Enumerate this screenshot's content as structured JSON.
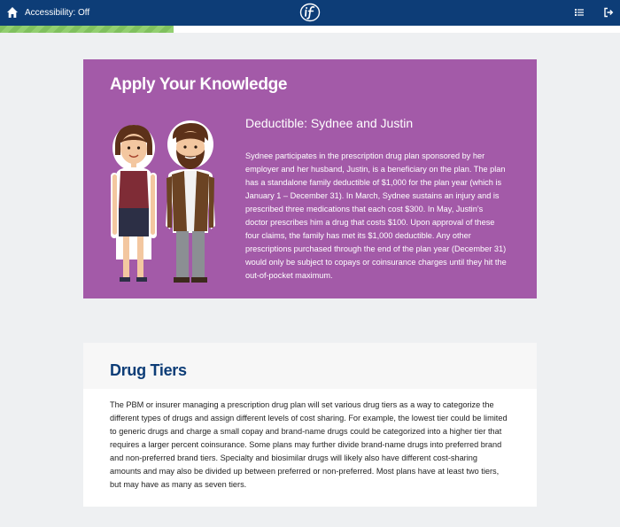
{
  "topbar": {
    "accessibility_label": "Accessibility: Off",
    "home_icon": "home-icon",
    "logo_icon": "if-logo",
    "menu_icon": "list-menu-icon",
    "exit_icon": "exit-icon",
    "background": "#0d3d77"
  },
  "progress": {
    "fraction": 0.28,
    "color": "#7fc05e"
  },
  "apply_knowledge": {
    "heading": "Apply Your Knowledge",
    "subheading": "Deductible: Sydnee and Justin",
    "body": "Sydnee participates in the prescription drug plan sponsored by her employer and her husband, Justin, is a beneficiary on the plan. The plan has a standalone family deductible of $1,000 for the plan year (which is January 1 – December 31). In March, Sydnee sustains an injury and is prescribed three medications that each cost $300. In May, Justin’s doctor prescribes him a drug that costs $100. Upon approval of these four claims, the family has met its $1,000 deductible. Any other prescriptions purchased through the end of the plan year (December 31) would only be subject to copays or coinsurance charges until they hit the out-of-pocket maximum.",
    "background": "#a35aa8"
  },
  "drug_tiers": {
    "heading": "Drug Tiers",
    "body": "The PBM or insurer managing a prescription drug plan will set various drug tiers as a way to categorize the different types of drugs and assign different levels of cost sharing. For example, the lowest tier could be limited to generic drugs and charge a small copay and brand-name drugs could be categorized into a higher tier that requires a larger percent coinsurance. Some plans may further divide brand-name drugs into preferred brand and non-preferred brand tiers. Specialty and biosimilar drugs will likely also have different cost-sharing amounts and may also be divided up between preferred or non-preferred. Most plans have at least two tiers, but may have as many as seven tiers.",
    "heading_color": "#0d3d77"
  }
}
